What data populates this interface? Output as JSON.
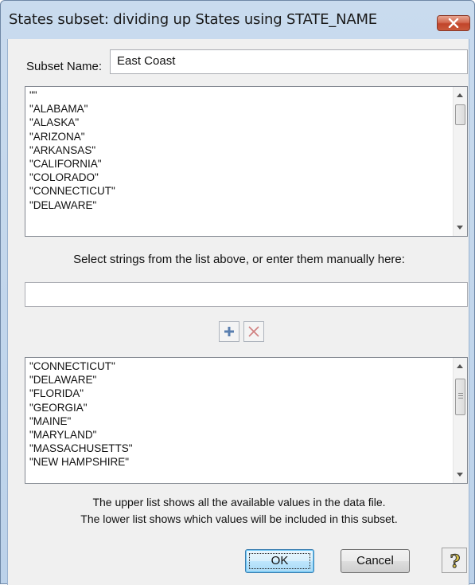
{
  "window": {
    "title": "States subset: dividing up States using STATE_NAME"
  },
  "form": {
    "subset_name_label": "Subset Name:",
    "subset_name_value": "East Coast",
    "instruction": "Select strings from the list above, or enter them manually here:",
    "manual_entry_value": ""
  },
  "upper_list": {
    "items": [
      "\"\"",
      "\"ALABAMA\"",
      "\"ALASKA\"",
      "\"ARIZONA\"",
      "\"ARKANSAS\"",
      "\"CALIFORNIA\"",
      "\"COLORADO\"",
      "\"CONNECTICUT\"",
      "\"DELAWARE\""
    ],
    "scroll_fraction": 0.0
  },
  "lower_list": {
    "items": [
      "\"CONNECTICUT\"",
      "\"DELAWARE\"",
      "\"FLORIDA\"",
      "\"GEORGIA\"",
      "\"MAINE\"",
      "\"MARYLAND\"",
      "\"MASSACHUSETTS\"",
      "\"NEW HAMPSHIRE\""
    ],
    "scroll_fraction": 0.5
  },
  "info": {
    "line1": "The upper list shows all the available values in the data file.",
    "line2": "The lower list shows which values will be included in this subset."
  },
  "buttons": {
    "ok": "OK",
    "cancel": "Cancel",
    "help": "?"
  },
  "icons": {
    "close": "close-icon",
    "add": "plus-icon",
    "remove": "x-icon",
    "help": "help-icon"
  },
  "colors": {
    "title_bg": "#bcd2ea",
    "close_red": "#c1452a",
    "ok_blue": "#3c7fb1"
  }
}
